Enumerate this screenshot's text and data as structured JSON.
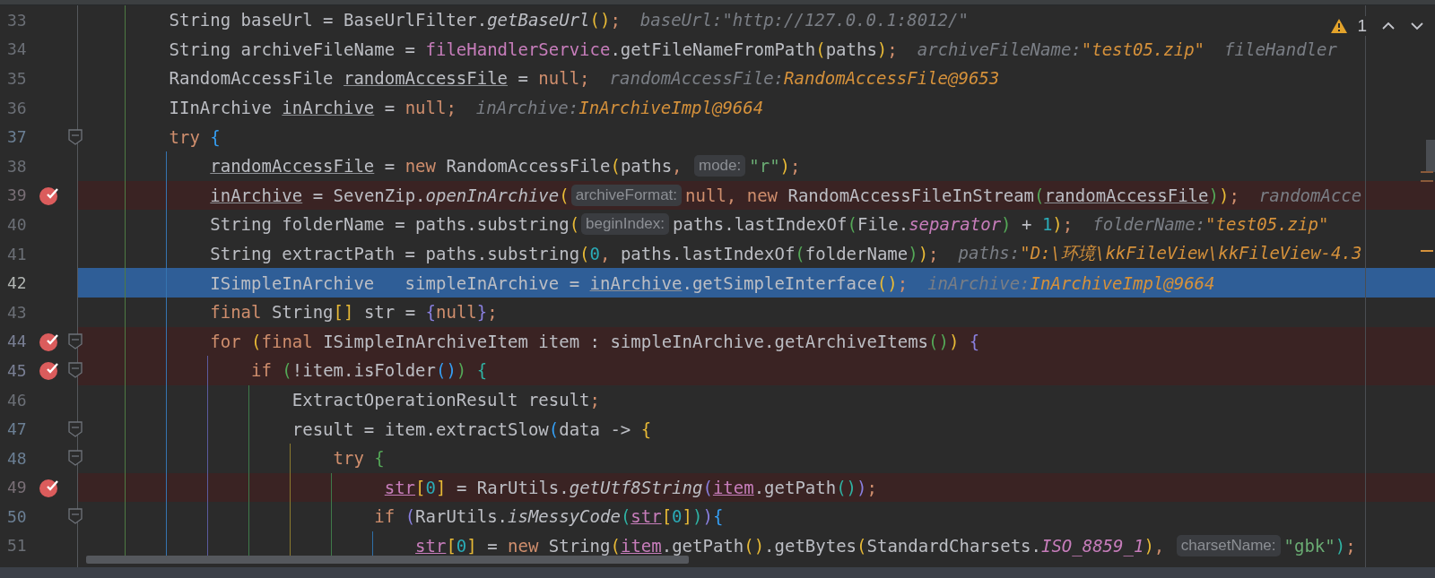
{
  "inspections": {
    "count": "1"
  },
  "lines": [
    {
      "number": "33",
      "breakpoint": false,
      "current": false,
      "foldable": false,
      "segments": [
        {
          "kind": "code",
          "tokens": [
            {
              "kind": "plain",
              "text": "        String baseUrl = BaseUrlFilter."
            },
            {
              "kind": "ital",
              "text": "getBaseUrl"
            },
            {
              "kind": "b1",
              "text": "()"
            },
            {
              "kind": "kw",
              "text": ";"
            }
          ]
        },
        {
          "kind": "debug",
          "name": "baseUrl:",
          "value": "\"http://127.0.0.1:8012/\"",
          "changed": false
        }
      ]
    },
    {
      "number": "34",
      "breakpoint": false,
      "current": false,
      "foldable": false,
      "segments": [
        {
          "kind": "code",
          "tokens": [
            {
              "kind": "plain",
              "text": "        String archiveFileName = "
            },
            {
              "kind": "field",
              "text": "fileHandlerService"
            },
            {
              "kind": "plain",
              "text": ".getFileNameFromPath"
            },
            {
              "kind": "b1",
              "text": "("
            },
            {
              "kind": "plain",
              "text": "paths"
            },
            {
              "kind": "b1",
              "text": ")"
            },
            {
              "kind": "kw",
              "text": ";"
            }
          ]
        },
        {
          "kind": "debug",
          "name": "archiveFileName:",
          "value": "\"test05.zip\"",
          "changed": true
        },
        {
          "kind": "debug",
          "name": "fileHandler"
        }
      ]
    },
    {
      "number": "35",
      "breakpoint": false,
      "current": false,
      "foldable": false,
      "segments": [
        {
          "kind": "code",
          "tokens": [
            {
              "kind": "plain",
              "text": "        RandomAccessFile "
            },
            {
              "kind": "ul",
              "text": "randomAccessFile"
            },
            {
              "kind": "plain",
              "text": " = "
            },
            {
              "kind": "kw",
              "text": "null;"
            }
          ]
        },
        {
          "kind": "debug",
          "name": "randomAccessFile:",
          "value": "RandomAccessFile@9653",
          "changed": true
        }
      ]
    },
    {
      "number": "36",
      "breakpoint": false,
      "current": false,
      "foldable": false,
      "segments": [
        {
          "kind": "code",
          "tokens": [
            {
              "kind": "plain",
              "text": "        IInArchive "
            },
            {
              "kind": "ul",
              "text": "inArchive"
            },
            {
              "kind": "plain",
              "text": " = "
            },
            {
              "kind": "kw",
              "text": "null;"
            }
          ]
        },
        {
          "kind": "debug",
          "name": "inArchive:",
          "value": "InArchiveImpl@9664",
          "changed": true
        }
      ]
    },
    {
      "number": "37",
      "breakpoint": false,
      "current": false,
      "foldable": true,
      "segments": [
        {
          "kind": "code",
          "tokens": [
            {
              "kind": "kw",
              "text": "        try "
            },
            {
              "kind": "b3",
              "text": "{"
            }
          ]
        }
      ]
    },
    {
      "number": "38",
      "breakpoint": false,
      "current": false,
      "foldable": false,
      "segments": [
        {
          "kind": "code",
          "tokens": [
            {
              "kind": "ul",
              "text": "            randomAccessFile"
            },
            {
              "kind": "plain",
              "text": " = "
            },
            {
              "kind": "kw",
              "text": "new "
            },
            {
              "kind": "plain",
              "text": "RandomAccessFile"
            },
            {
              "kind": "b1",
              "text": "("
            },
            {
              "kind": "plain",
              "text": "paths"
            },
            {
              "kind": "kw",
              "text": ", "
            }
          ]
        },
        {
          "kind": "hint",
          "text": "mode:"
        },
        {
          "kind": "code",
          "tokens": [
            {
              "kind": "str",
              "text": "\"r\""
            },
            {
              "kind": "b1",
              "text": ")"
            },
            {
              "kind": "kw",
              "text": ";"
            }
          ]
        }
      ]
    },
    {
      "number": "39",
      "breakpoint": true,
      "current": false,
      "foldable": false,
      "segments": [
        {
          "kind": "code",
          "tokens": [
            {
              "kind": "ul",
              "text": "            inArchive"
            },
            {
              "kind": "plain",
              "text": " = SevenZip."
            },
            {
              "kind": "ital",
              "text": "openInArchive"
            },
            {
              "kind": "b1",
              "text": "("
            }
          ]
        },
        {
          "kind": "hint",
          "text": "archiveFormat:"
        },
        {
          "kind": "code",
          "tokens": [
            {
              "kind": "kw",
              "text": "null, new "
            },
            {
              "kind": "plain",
              "text": "RandomAccessFileInStream"
            },
            {
              "kind": "b2",
              "text": "("
            },
            {
              "kind": "ul",
              "text": "randomAccessFile"
            },
            {
              "kind": "b2",
              "text": ")"
            },
            {
              "kind": "b1",
              "text": ")"
            },
            {
              "kind": "kw",
              "text": ";"
            }
          ]
        },
        {
          "kind": "debug",
          "name": "randomAcce"
        }
      ]
    },
    {
      "number": "40",
      "breakpoint": false,
      "current": false,
      "foldable": false,
      "segments": [
        {
          "kind": "code",
          "tokens": [
            {
              "kind": "plain",
              "text": "            String folderName = paths.substring"
            },
            {
              "kind": "b1",
              "text": "("
            }
          ]
        },
        {
          "kind": "hint",
          "text": "beginIndex:"
        },
        {
          "kind": "code",
          "tokens": [
            {
              "kind": "plain",
              "text": "paths.lastIndexOf"
            },
            {
              "kind": "b2",
              "text": "("
            },
            {
              "kind": "plain",
              "text": "File."
            },
            {
              "kind": "sfield",
              "text": "separator"
            },
            {
              "kind": "b2",
              "text": ")"
            },
            {
              "kind": "plain",
              "text": " + "
            },
            {
              "kind": "num",
              "text": "1"
            },
            {
              "kind": "b1",
              "text": ")"
            },
            {
              "kind": "kw",
              "text": ";"
            }
          ]
        },
        {
          "kind": "debug",
          "name": "folderName:",
          "value": "\"test05.zip\"",
          "changed": true
        }
      ]
    },
    {
      "number": "41",
      "breakpoint": false,
      "current": false,
      "foldable": false,
      "segments": [
        {
          "kind": "code",
          "tokens": [
            {
              "kind": "plain",
              "text": "            String extractPath = paths.substring"
            },
            {
              "kind": "b1",
              "text": "("
            },
            {
              "kind": "num",
              "text": "0"
            },
            {
              "kind": "kw",
              "text": ", "
            },
            {
              "kind": "plain",
              "text": "paths.lastIndexOf"
            },
            {
              "kind": "b2",
              "text": "("
            },
            {
              "kind": "plain",
              "text": "folderName"
            },
            {
              "kind": "b2",
              "text": ")"
            },
            {
              "kind": "b1",
              "text": ")"
            },
            {
              "kind": "kw",
              "text": ";"
            }
          ]
        },
        {
          "kind": "debug",
          "name": "paths:",
          "value": "\"D:\\环境\\kkFileView\\kkFileView-4.3",
          "changed": true
        }
      ]
    },
    {
      "number": "42",
      "breakpoint": false,
      "current": true,
      "foldable": false,
      "segments": [
        {
          "kind": "code",
          "tokens": [
            {
              "kind": "plain",
              "text": "            ISimpleInArchive   simpleInArchive = "
            },
            {
              "kind": "ul",
              "text": "inArchive"
            },
            {
              "kind": "plain",
              "text": ".getSimpleInterface"
            },
            {
              "kind": "b1",
              "text": "()"
            },
            {
              "kind": "kw",
              "text": ";"
            }
          ]
        },
        {
          "kind": "debug",
          "name": "inArchive:",
          "value": "InArchiveImpl@9664",
          "changed": true
        }
      ]
    },
    {
      "number": "43",
      "breakpoint": false,
      "current": false,
      "foldable": false,
      "segments": [
        {
          "kind": "code",
          "tokens": [
            {
              "kind": "kw",
              "text": "            final "
            },
            {
              "kind": "plain",
              "text": "String"
            },
            {
              "kind": "b1",
              "text": "[]"
            },
            {
              "kind": "plain",
              "text": " str = "
            },
            {
              "kind": "b4",
              "text": "{"
            },
            {
              "kind": "kw",
              "text": "null"
            },
            {
              "kind": "b4",
              "text": "}"
            },
            {
              "kind": "kw",
              "text": ";"
            }
          ]
        }
      ]
    },
    {
      "number": "44",
      "breakpoint": true,
      "current": false,
      "foldable": true,
      "segments": [
        {
          "kind": "code",
          "tokens": [
            {
              "kind": "kw",
              "text": "            for "
            },
            {
              "kind": "b1",
              "text": "("
            },
            {
              "kind": "kw",
              "text": "final "
            },
            {
              "kind": "plain",
              "text": "ISimpleInArchiveItem item : simpleInArchive.getArchiveItems"
            },
            {
              "kind": "b2",
              "text": "()"
            },
            {
              "kind": "b1",
              "text": ")"
            },
            {
              "kind": "b4",
              "text": " {"
            }
          ]
        }
      ]
    },
    {
      "number": "45",
      "breakpoint": true,
      "current": false,
      "foldable": true,
      "segments": [
        {
          "kind": "code",
          "tokens": [
            {
              "kind": "kw",
              "text": "                if "
            },
            {
              "kind": "b2",
              "text": "("
            },
            {
              "kind": "plain",
              "text": "!item.isFolder"
            },
            {
              "kind": "b3",
              "text": "()"
            },
            {
              "kind": "b2",
              "text": ")"
            },
            {
              "kind": "b5",
              "text": " {"
            }
          ]
        }
      ]
    },
    {
      "number": "46",
      "breakpoint": false,
      "current": false,
      "foldable": false,
      "segments": [
        {
          "kind": "code",
          "tokens": [
            {
              "kind": "plain",
              "text": "                    ExtractOperationResult result"
            },
            {
              "kind": "kw",
              "text": ";"
            }
          ]
        }
      ]
    },
    {
      "number": "47",
      "breakpoint": false,
      "current": false,
      "foldable": true,
      "segments": [
        {
          "kind": "code",
          "tokens": [
            {
              "kind": "plain",
              "text": "                    result = item.extractSlow"
            },
            {
              "kind": "b3",
              "text": "("
            },
            {
              "kind": "plain",
              "text": "data -> "
            },
            {
              "kind": "b1",
              "text": "{"
            }
          ]
        }
      ]
    },
    {
      "number": "48",
      "breakpoint": false,
      "current": false,
      "foldable": true,
      "segments": [
        {
          "kind": "code",
          "tokens": [
            {
              "kind": "kw",
              "text": "                        try "
            },
            {
              "kind": "b2",
              "text": "{"
            }
          ]
        }
      ]
    },
    {
      "number": "49",
      "breakpoint": true,
      "current": false,
      "foldable": false,
      "segments": [
        {
          "kind": "code",
          "tokens": [
            {
              "kind": "ulf",
              "text": "                             str"
            },
            {
              "kind": "b1",
              "text": "["
            },
            {
              "kind": "num",
              "text": "0"
            },
            {
              "kind": "b1",
              "text": "]"
            },
            {
              "kind": "plain",
              "text": " = RarUtils."
            },
            {
              "kind": "ital",
              "text": "getUtf8String"
            },
            {
              "kind": "b4",
              "text": "("
            },
            {
              "kind": "ulf",
              "text": "item"
            },
            {
              "kind": "plain",
              "text": ".getPath"
            },
            {
              "kind": "b5",
              "text": "()"
            },
            {
              "kind": "b4",
              "text": ")"
            },
            {
              "kind": "kw",
              "text": ";"
            }
          ]
        }
      ]
    },
    {
      "number": "50",
      "breakpoint": false,
      "current": false,
      "foldable": true,
      "segments": [
        {
          "kind": "code",
          "tokens": [
            {
              "kind": "kw",
              "text": "                            if "
            },
            {
              "kind": "b4",
              "text": "("
            },
            {
              "kind": "plain",
              "text": "RarUtils."
            },
            {
              "kind": "ital",
              "text": "isMessyCode"
            },
            {
              "kind": "b5",
              "text": "("
            },
            {
              "kind": "ulf",
              "text": "str"
            },
            {
              "kind": "b1",
              "text": "["
            },
            {
              "kind": "num",
              "text": "0"
            },
            {
              "kind": "b1",
              "text": "]"
            },
            {
              "kind": "b5",
              "text": ")"
            },
            {
              "kind": "b4",
              "text": ")"
            },
            {
              "kind": "b3",
              "text": "{"
            }
          ]
        }
      ]
    },
    {
      "number": "51",
      "breakpoint": false,
      "current": false,
      "foldable": false,
      "segments": [
        {
          "kind": "code",
          "tokens": [
            {
              "kind": "ulf",
              "text": "                                str"
            },
            {
              "kind": "b1",
              "text": "["
            },
            {
              "kind": "num",
              "text": "0"
            },
            {
              "kind": "b1",
              "text": "]"
            },
            {
              "kind": "plain",
              "text": " = "
            },
            {
              "kind": "kw",
              "text": "new "
            },
            {
              "kind": "plain",
              "text": "String"
            },
            {
              "kind": "b1",
              "text": "("
            },
            {
              "kind": "ulf",
              "text": "item"
            },
            {
              "kind": "plain",
              "text": ".getPath"
            },
            {
              "kind": "b1",
              "text": "()"
            },
            {
              "kind": "plain",
              "text": ".getBytes"
            },
            {
              "kind": "b1",
              "text": "("
            },
            {
              "kind": "plain",
              "text": "StandardCharsets."
            },
            {
              "kind": "sfield",
              "text": "ISO_8859_1"
            },
            {
              "kind": "b1",
              "text": ")"
            },
            {
              "kind": "kw",
              "text": ", "
            }
          ]
        },
        {
          "kind": "hint",
          "text": "charsetName:"
        },
        {
          "kind": "code",
          "tokens": [
            {
              "kind": "str",
              "text": "\"gbk\""
            },
            {
              "kind": "b5",
              "text": ")"
            },
            {
              "kind": "kw",
              "text": ";"
            }
          ]
        }
      ]
    }
  ]
}
